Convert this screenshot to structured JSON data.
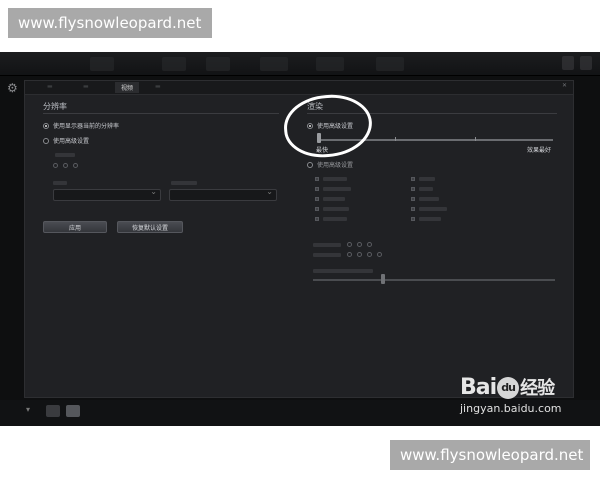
{
  "watermark": {
    "text_top": "www.flysnowleopard.net",
    "text_bottom": "www.flysnowleopard.net"
  },
  "tabs": {
    "video": "视频"
  },
  "resolution": {
    "title": "分辨率",
    "use_display_label": "使用显示器当前的分辨率",
    "use_advanced_label": "使用高级设置",
    "apply_button": "应用",
    "restore_button": "恢复默认设置"
  },
  "render": {
    "title": "渲染",
    "use_advanced_label": "使用高级设置",
    "fastest_label": "最快",
    "best_label": "效果最好",
    "use_advanced_label_2": "使用高级设置"
  },
  "baidu": {
    "logo_bai": "Bai",
    "logo_du": "du",
    "logo_cn": "经验",
    "url": "jingyan.baidu.com"
  },
  "colors": {
    "panel_bg": "#202124",
    "annotation": "#ffffff"
  }
}
